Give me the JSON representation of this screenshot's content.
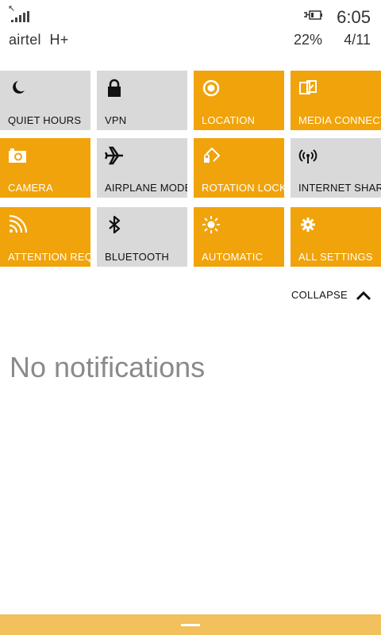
{
  "status_bar": {
    "carrier": "airtel",
    "network": "H+",
    "time": "6:05",
    "battery_percent": "22%",
    "date": "4/11"
  },
  "tiles": [
    {
      "label": "QUIET HOURS",
      "icon": "moon-icon",
      "state": "off"
    },
    {
      "label": "VPN",
      "icon": "lock-icon",
      "state": "off"
    },
    {
      "label": "LOCATION",
      "icon": "location-icon",
      "state": "on"
    },
    {
      "label": "MEDIA CONNECT",
      "icon": "media-connect-icon",
      "state": "on"
    },
    {
      "label": "CAMERA",
      "icon": "camera-icon",
      "state": "on"
    },
    {
      "label": "AIRPLANE MODE",
      "icon": "airplane-icon",
      "state": "off"
    },
    {
      "label": "ROTATION LOCK",
      "icon": "rotation-lock-icon",
      "state": "on"
    },
    {
      "label": "INTERNET SHARING",
      "icon": "internet-sharing-icon",
      "state": "off"
    },
    {
      "label": "ATTENTION REQUIRED",
      "icon": "wifi-icon",
      "state": "on"
    },
    {
      "label": "BLUETOOTH",
      "icon": "bluetooth-icon",
      "state": "off"
    },
    {
      "label": "AUTOMATIC",
      "icon": "brightness-icon",
      "state": "on"
    },
    {
      "label": "ALL SETTINGS",
      "icon": "gear-icon",
      "state": "on"
    }
  ],
  "collapse_label": "COLLAPSE",
  "notifications": {
    "empty_text": "No notifications"
  },
  "colors": {
    "accent": "#f0a30a",
    "tile_off": "#d9d9d9",
    "bottom_bar": "#f2c05c"
  }
}
